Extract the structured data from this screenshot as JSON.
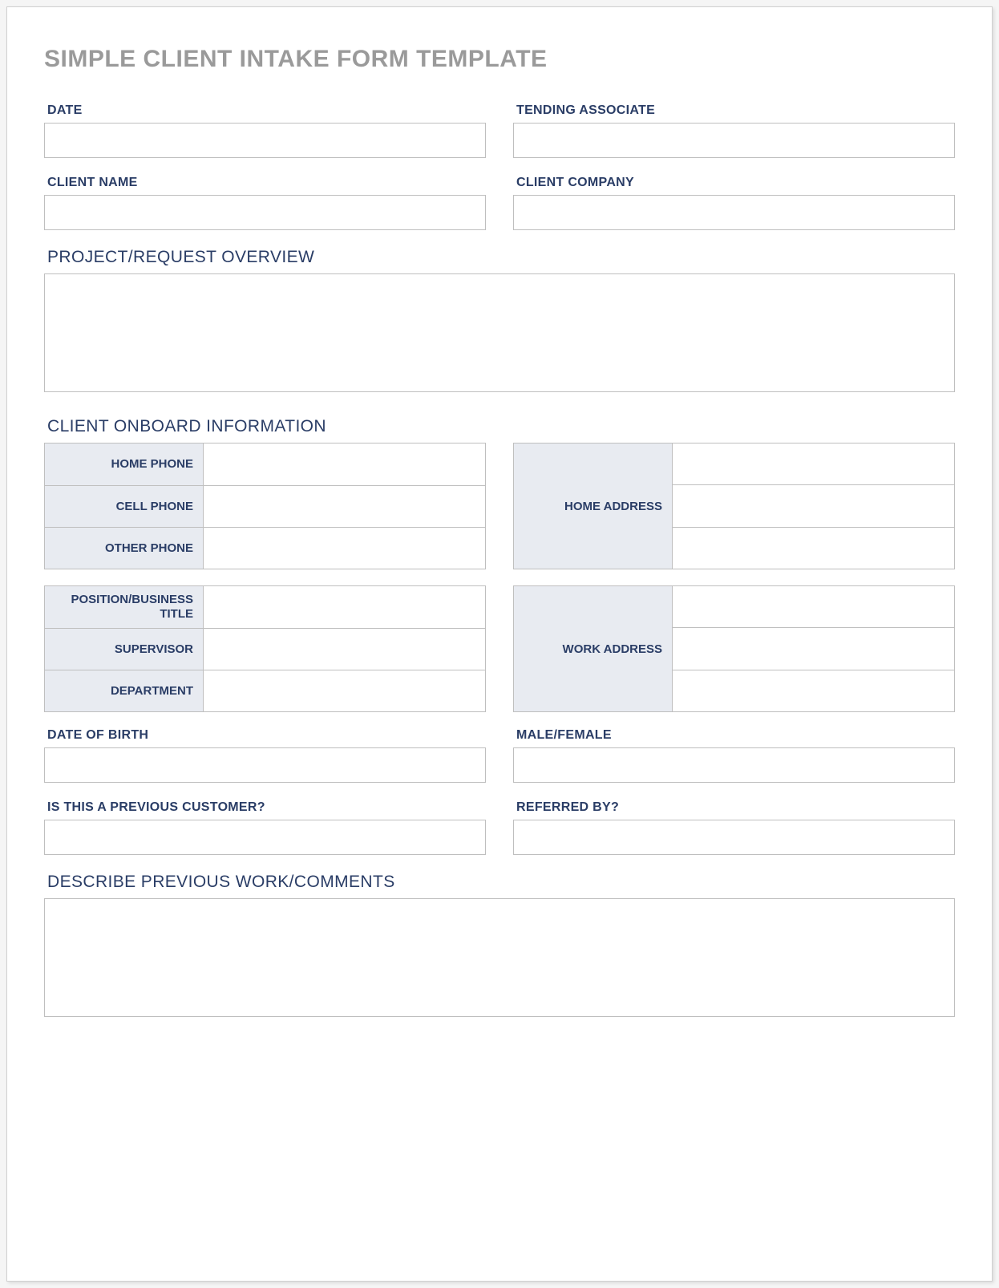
{
  "title": "SIMPLE CLIENT INTAKE FORM TEMPLATE",
  "top": {
    "date_label": "DATE",
    "date_value": "",
    "associate_label": "TENDING ASSOCIATE",
    "associate_value": "",
    "client_name_label": "CLIENT NAME",
    "client_name_value": "",
    "client_company_label": "CLIENT COMPANY",
    "client_company_value": ""
  },
  "overview": {
    "label": "PROJECT/REQUEST OVERVIEW",
    "value": ""
  },
  "onboard": {
    "section_label": "CLIENT ONBOARD INFORMATION",
    "home_phone_label": "HOME PHONE",
    "home_phone_value": "",
    "cell_phone_label": "CELL PHONE",
    "cell_phone_value": "",
    "other_phone_label": "OTHER PHONE",
    "other_phone_value": "",
    "home_address_label": "HOME ADDRESS",
    "home_address_line1": "",
    "home_address_line2": "",
    "home_address_line3": "",
    "position_title_label": "POSITION/BUSINESS TITLE",
    "position_title_value": "",
    "supervisor_label": "SUPERVISOR",
    "supervisor_value": "",
    "department_label": "DEPARTMENT",
    "department_value": "",
    "work_address_label": "WORK ADDRESS",
    "work_address_line1": "",
    "work_address_line2": "",
    "work_address_line3": ""
  },
  "details": {
    "dob_label": "DATE OF BIRTH",
    "dob_value": "",
    "gender_label": "MALE/FEMALE",
    "gender_value": "",
    "prev_customer_label": "IS THIS A PREVIOUS CUSTOMER?",
    "prev_customer_value": "",
    "referred_label": "REFERRED BY?",
    "referred_value": ""
  },
  "comments": {
    "label": "DESCRIBE PREVIOUS WORK/COMMENTS",
    "value": ""
  }
}
